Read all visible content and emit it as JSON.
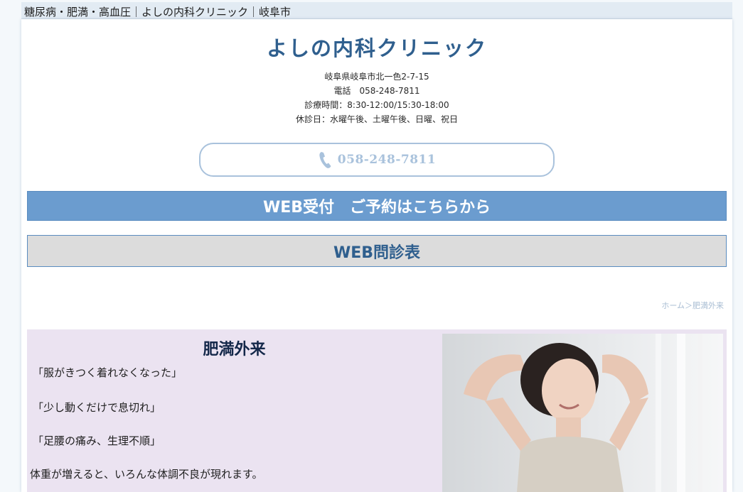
{
  "top_strip": {
    "tagline": "糖尿病・肥満・高血圧｜よしの内科クリニック｜岐阜市"
  },
  "header": {
    "clinic_name": "よしの内科クリニック",
    "address": "岐阜県岐阜市北一色2-7-15",
    "phone_line": "電話　058-248-7811",
    "hours": "診療時間：8:30-12:00/15:30-18:00",
    "closed_days": "休診日：水曜午後、土曜午後、日曜、祝日"
  },
  "phone_button": {
    "number": "058-248-7811",
    "icon": "phone-handset-icon"
  },
  "buttons": {
    "web_reserve": "WEB受付　ご予約はこちらから",
    "web_interview": "WEB問診表"
  },
  "breadcrumb": {
    "home": "ホーム",
    "separator": "＞",
    "current": "肥満外来"
  },
  "section": {
    "title": "肥満外来",
    "quotes": [
      "「服がきつく着れなくなった」",
      "「少し動くだけで息切れ」",
      "「足腰の痛み、生理不順」"
    ],
    "body": "体重が増えると、いろんな体調不良が現れます。"
  },
  "colors": {
    "brand_blue": "#2f5f8e",
    "button_blue": "#6b9ccf",
    "phone_border": "#a9c2dc",
    "content_bg": "#ebe3f1"
  }
}
